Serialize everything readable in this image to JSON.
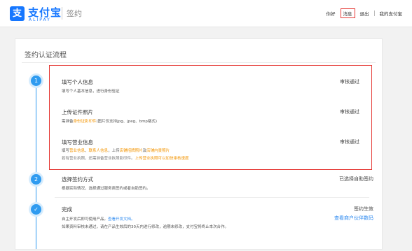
{
  "header": {
    "logo_icon": "支",
    "logo_cn": "支付宝",
    "logo_en": "ALIPAY",
    "page_title": "签约",
    "nav": {
      "greeting": "你好",
      "message": "消息",
      "logout": "退出",
      "my_alipay": "我的支付宝"
    }
  },
  "card": {
    "title": "签约认证流程",
    "steps": [
      {
        "number": "1",
        "items": [
          {
            "title": "填写个人信息",
            "desc": "填写个人基本信息，进行身份验证",
            "status": "审核通过"
          },
          {
            "title": "上传证件照片",
            "desc_prefix": "需准备",
            "desc_link": "身份证影印件",
            "desc_suffix": "(图片仅支持jpg、jpeg、bmp格式)",
            "status": "审核通过"
          },
          {
            "title": "填写营业信息",
            "desc1_a": "填写",
            "desc1_b": "营业信息",
            "desc1_c": "、",
            "desc1_d": "联系人信息",
            "desc1_e": "，上传",
            "desc1_f": "店铺招牌照片",
            "desc1_g": "及",
            "desc1_h": "店铺内景照片",
            "desc2_a": "若有营业执照，还需准备营业执照影印件。",
            "desc2_b": "上传营业执照可以加快审核速度",
            "status": "审核通过"
          }
        ]
      },
      {
        "number": "2",
        "title": "选择签约方式",
        "desc": "根据实际情况，选择通过服务商签约或者自助签约。",
        "status": "已选择自助签约"
      },
      {
        "number": "✓",
        "title": "完成",
        "desc1_a": "自主开发后即可使用产品。",
        "desc1_b": "查看开发文档。",
        "desc2": "如果资料审核未通过，请在产品生效后的30天内进行修改，逾期未修改，支付宝将终止本次合作。",
        "status": "签约生效",
        "status_link": "查看商户伙伴数码"
      }
    ]
  },
  "colors": {
    "brand": "#1677ff",
    "timeline": "#2f9bf0",
    "highlight_box": "#e53935",
    "orange_link": "#f39400"
  }
}
